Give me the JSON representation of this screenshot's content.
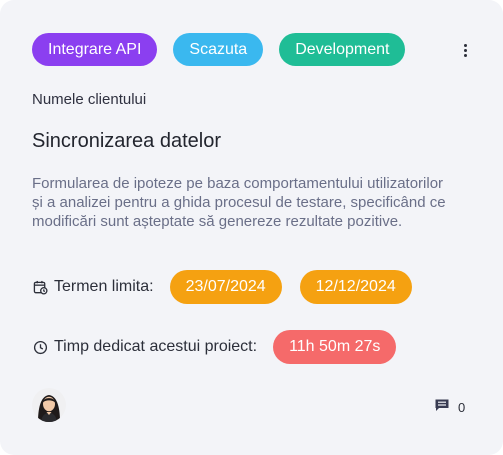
{
  "tags": [
    {
      "label": "Integrare API",
      "color": "#8b3ff0"
    },
    {
      "label": "Scazuta",
      "color": "#3ab8ef"
    },
    {
      "label": "Development",
      "color": "#1fbd96"
    }
  ],
  "menu_icon": "more-vertical-icon",
  "client_name": "Numele clientului",
  "title": "Sincronizarea datelor",
  "description": "Formularea de ipoteze pe baza comportamentului utilizatorilor și a analizei pentru a ghida procesul de testare, specificând ce modificări sunt așteptate să genereze rezultate pozitive.",
  "deadline": {
    "icon": "calendar-clock-icon",
    "label": "Termen limita:",
    "dates": [
      "23/07/2024",
      "12/12/2024"
    ],
    "color": "#f5a111"
  },
  "time_spent": {
    "icon": "clock-icon",
    "label": "Timp dedicat acestui proiect:",
    "value": "11h 50m 27s",
    "color": "#f56a6a"
  },
  "footer": {
    "avatar_icon": "user-avatar",
    "comment_icon": "comment-icon",
    "comment_count": "0"
  }
}
